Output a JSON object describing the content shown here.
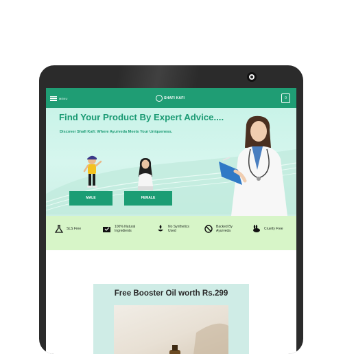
{
  "navbar": {
    "menu_label": "MENU",
    "logo_text": "SHAFI KAFI",
    "cart_count": "0"
  },
  "hero": {
    "title": "Find Your Product By Expert Advice....",
    "subtitle": "Discover Shafi Kafi: Where Ayurveda Meets Your Uniqueness.",
    "male_button": "MALE",
    "female_button": "FEMALE"
  },
  "features": [
    {
      "label": "SLS Free",
      "icon": "flask-icon"
    },
    {
      "label": "100% Natural Ingredients",
      "icon": "natural-box-icon"
    },
    {
      "label": "No Synthetics Used",
      "icon": "leaf-bowl-icon"
    },
    {
      "label": "Backed By Ayurveda",
      "icon": "no-sign-icon"
    },
    {
      "label": "Cruelty Free",
      "icon": "rabbit-icon"
    }
  ],
  "promo": {
    "title": "Free Booster Oil worth Rs.299"
  },
  "colors": {
    "brand_green": "#1f9d74",
    "hero_bg": "#cff4ea",
    "features_bg": "#d7f5c8",
    "promo_bg": "#cfece6"
  }
}
